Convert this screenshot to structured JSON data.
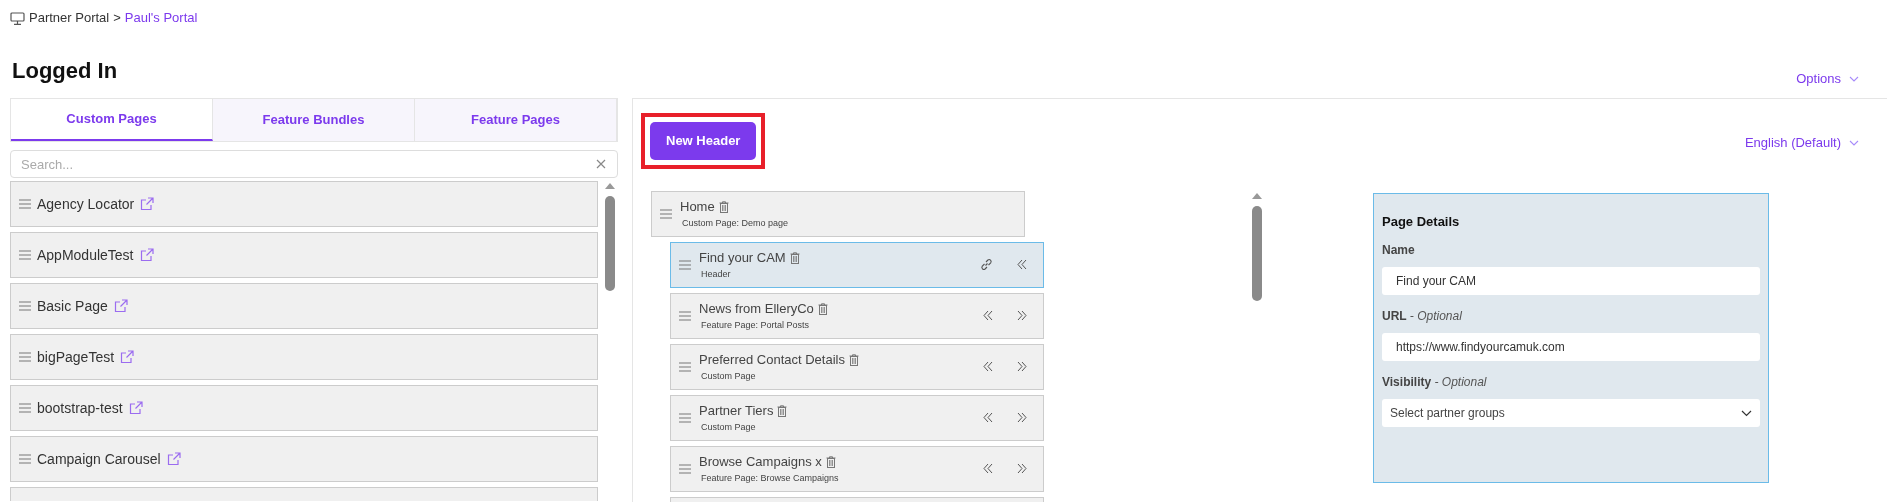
{
  "breadcrumb": [
    {
      "label": "Partner Portal",
      "kind": "root"
    },
    {
      "label": ">",
      "kind": "separator"
    },
    {
      "label": "Paul's Portal",
      "kind": "link"
    }
  ],
  "page_title": "Logged In",
  "options_menu": {
    "label": "Options"
  },
  "tabs": [
    {
      "label": "Custom Pages",
      "selected": true
    },
    {
      "label": "Feature Bundles",
      "selected": false
    },
    {
      "label": "Feature Pages",
      "selected": false
    }
  ],
  "search": {
    "placeholder": "Search..."
  },
  "pages": [
    {
      "label": "Agency Locator"
    },
    {
      "label": "AppModuleTest"
    },
    {
      "label": "Basic Page"
    },
    {
      "label": "bigPageTest"
    },
    {
      "label": "bootstrap-test"
    },
    {
      "label": "Campaign Carousel"
    }
  ],
  "new_header_button": {
    "label": "New Header",
    "highlighted": true
  },
  "language_menu": {
    "label": "English (Default)"
  },
  "tree": [
    {
      "title": "Home",
      "subtitle": "Custom Page: Demo page",
      "selected": false,
      "children": [
        {
          "title": "Find your CAM",
          "subtitle": "Header",
          "selected": true,
          "linkable": true,
          "can_outdent": true,
          "can_indent": false
        },
        {
          "title": "News from ElleryCo",
          "subtitle": "Feature Page: Portal Posts",
          "selected": false,
          "linkable": false,
          "can_outdent": true,
          "can_indent": true
        },
        {
          "title": "Preferred Contact Details",
          "subtitle": "Custom Page",
          "selected": false,
          "linkable": false,
          "can_outdent": true,
          "can_indent": true
        },
        {
          "title": "Partner Tiers",
          "subtitle": "Custom Page",
          "selected": false,
          "linkable": false,
          "can_outdent": true,
          "can_indent": true
        },
        {
          "title": "Browse Campaigns x",
          "subtitle": "Feature Page: Browse Campaigns",
          "selected": false,
          "linkable": false,
          "can_outdent": true,
          "can_indent": true
        }
      ]
    }
  ],
  "page_details": {
    "heading": "Page Details",
    "fields": [
      {
        "kind": "text",
        "label": "Name",
        "value": "Find your CAM"
      },
      {
        "kind": "text",
        "label": "URL",
        "hint": "- Optional",
        "value": "https://www.findyourcamuk.com"
      },
      {
        "kind": "select",
        "label": "Visibility",
        "hint": "- Optional",
        "placeholder": "Select partner groups"
      }
    ]
  }
}
